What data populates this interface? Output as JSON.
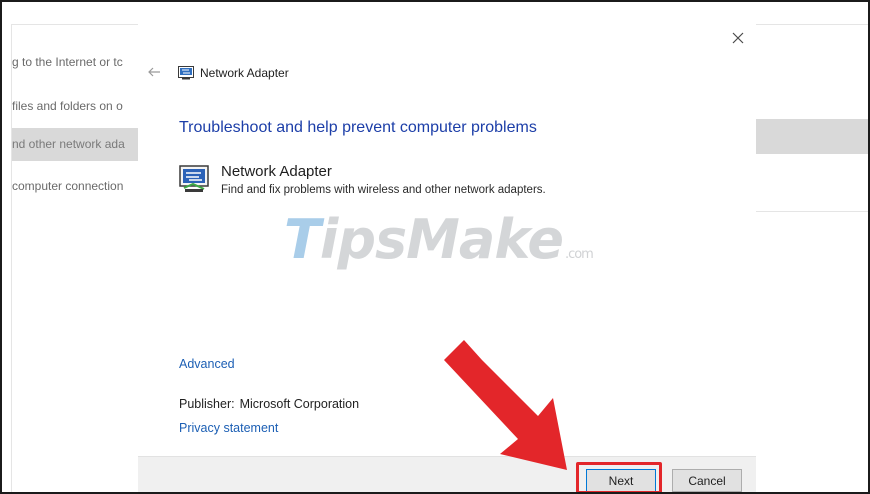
{
  "background_window": {
    "items": [
      {
        "label": "g to the Internet or tc",
        "selected": false
      },
      {
        "label": "files and folders on o",
        "selected": false
      },
      {
        "label": "nd other network ada",
        "selected": true
      },
      {
        "label": "computer connection",
        "selected": false
      }
    ]
  },
  "dialog": {
    "title": "Network Adapter",
    "heading": "Troubleshoot and help prevent computer problems",
    "troubleshooter": {
      "name": "Network Adapter",
      "description": "Find and fix problems with wireless and other network adapters."
    },
    "advanced_label": "Advanced",
    "publisher_label": "Publisher:",
    "publisher_value": "Microsoft Corporation",
    "privacy_label": "Privacy statement",
    "next_label": "Next",
    "cancel_label": "Cancel"
  },
  "watermark": {
    "first": "T",
    "rest": "ipsMake",
    "suffix": ".com"
  },
  "icons": {
    "close": "close-icon",
    "back": "back-arrow-icon",
    "adapter": "network-adapter-icon"
  },
  "colors": {
    "heading": "#1c3ea8",
    "link": "#1c5fb4",
    "highlight": "#e3262a"
  }
}
